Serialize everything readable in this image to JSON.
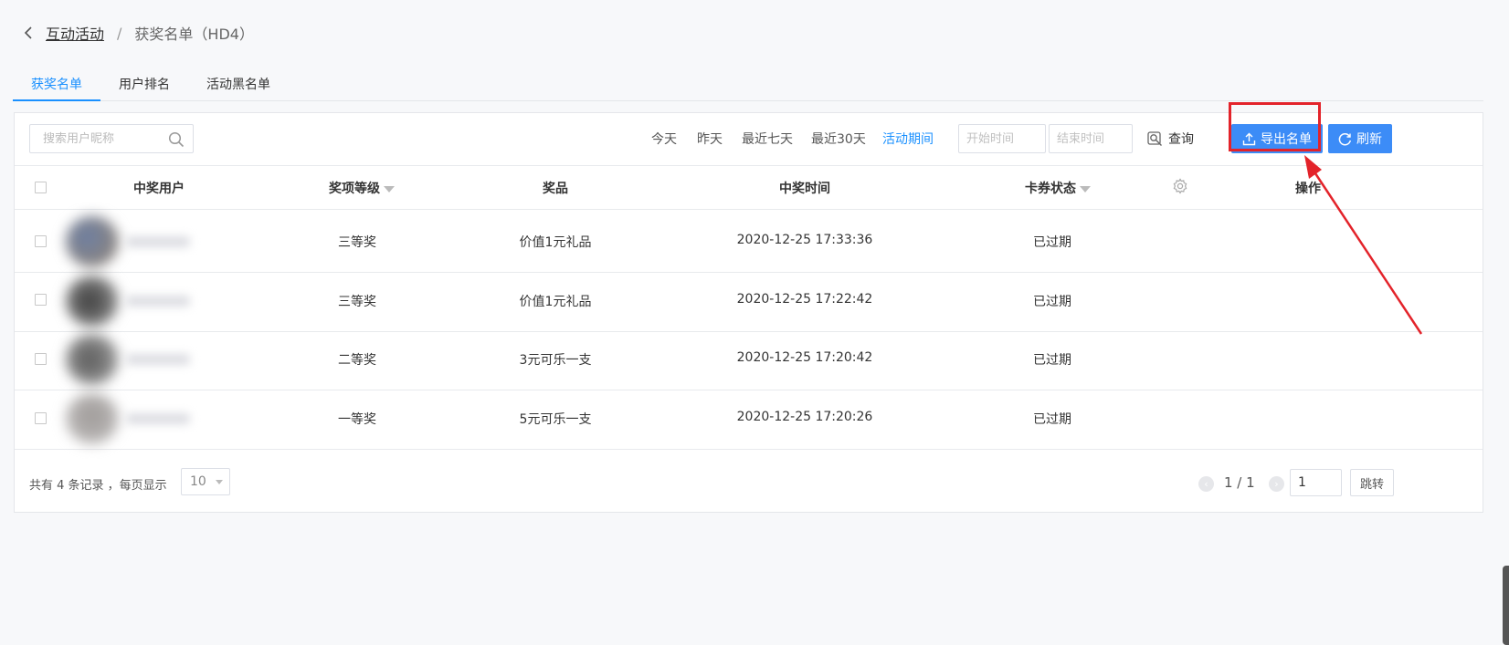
{
  "breadcrumb": {
    "parent": "互动活动",
    "separator": "/",
    "current": "获奖名单（HD4）"
  },
  "tabs": [
    {
      "label": "获奖名单",
      "active": true
    },
    {
      "label": "用户排名",
      "active": false
    },
    {
      "label": "活动黑名单",
      "active": false
    }
  ],
  "toolbar": {
    "search_placeholder": "搜索用户昵称",
    "ranges": [
      "今天",
      "昨天",
      "最近七天",
      "最近30天",
      "活动期间"
    ],
    "active_range": "活动期间",
    "start_placeholder": "开始时间",
    "end_placeholder": "结束时间",
    "query_label": "查询",
    "export_label": "导出名单",
    "refresh_label": "刷新"
  },
  "table": {
    "headers": {
      "user": "中奖用户",
      "level": "奖项等级",
      "prize": "奖品",
      "time": "中奖时间",
      "status": "卡券状态",
      "actions": "操作"
    },
    "rows": [
      {
        "level": "三等奖",
        "prize": "价值1元礼品",
        "time": "2020-12-25 17:33:36",
        "status": "已过期"
      },
      {
        "level": "三等奖",
        "prize": "价值1元礼品",
        "time": "2020-12-25 17:22:42",
        "status": "已过期"
      },
      {
        "level": "二等奖",
        "prize": "3元可乐一支",
        "time": "2020-12-25 17:20:42",
        "status": "已过期"
      },
      {
        "level": "一等奖",
        "prize": "5元可乐一支",
        "time": "2020-12-25 17:20:26",
        "status": "已过期"
      }
    ]
  },
  "footer": {
    "total_text": "共有 4 条记录 ，每页显示",
    "page_size": "10",
    "page_indicator": "1 / 1",
    "page_input": "1",
    "jump_label": "跳转"
  },
  "colors": {
    "accent": "#1a90ff",
    "button": "#3c8cf7",
    "annotation": "#e3232a"
  }
}
